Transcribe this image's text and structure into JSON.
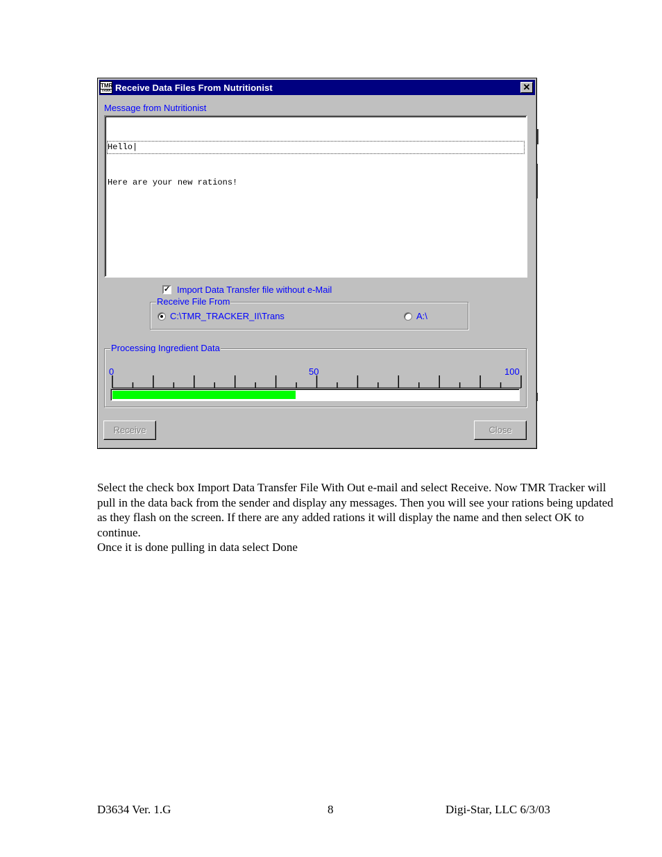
{
  "dialog": {
    "title": "Receive Data Files From Nutritionist",
    "app_icon_text": "TMR",
    "app_icon_subtext": "TRAK",
    "close_label": "✕",
    "message_label": "Message from Nutritionist",
    "message_lines": [
      "Hello|",
      "Here are your new rations!"
    ],
    "import_checkbox": {
      "label": "Import Data Transfer file without e-Mail",
      "checked": true,
      "check_glyph": "✓"
    },
    "receive_from": {
      "legend": "Receive File From",
      "options": [
        {
          "label": "C:\\TMR_TRACKER_II\\Trans",
          "selected": true
        },
        {
          "label": "A:\\",
          "selected": false
        }
      ]
    },
    "progress": {
      "legend": "Processing Ingredient Data",
      "scale_labels": [
        "0",
        "50",
        "100"
      ],
      "min": 0,
      "max": 100,
      "value": 45,
      "fill_color": "#00ff00"
    },
    "buttons": {
      "receive": "Receive",
      "close": "Close"
    }
  },
  "body_text": {
    "paragraph": "Select the check box Import Data Transfer File With Out e-mail and select Receive.  Now TMR Tracker will pull in the data back from the sender and display any messages. Then you will see your rations being updated as they flash on the screen.  If there are any added rations it will display the name and then select OK to continue.",
    "line2": "Once it is done pulling in data select Done"
  },
  "footer": {
    "left": "D3634  Ver. 1.G",
    "center": "8",
    "right": "Digi-Star, LLC  6/3/03"
  }
}
